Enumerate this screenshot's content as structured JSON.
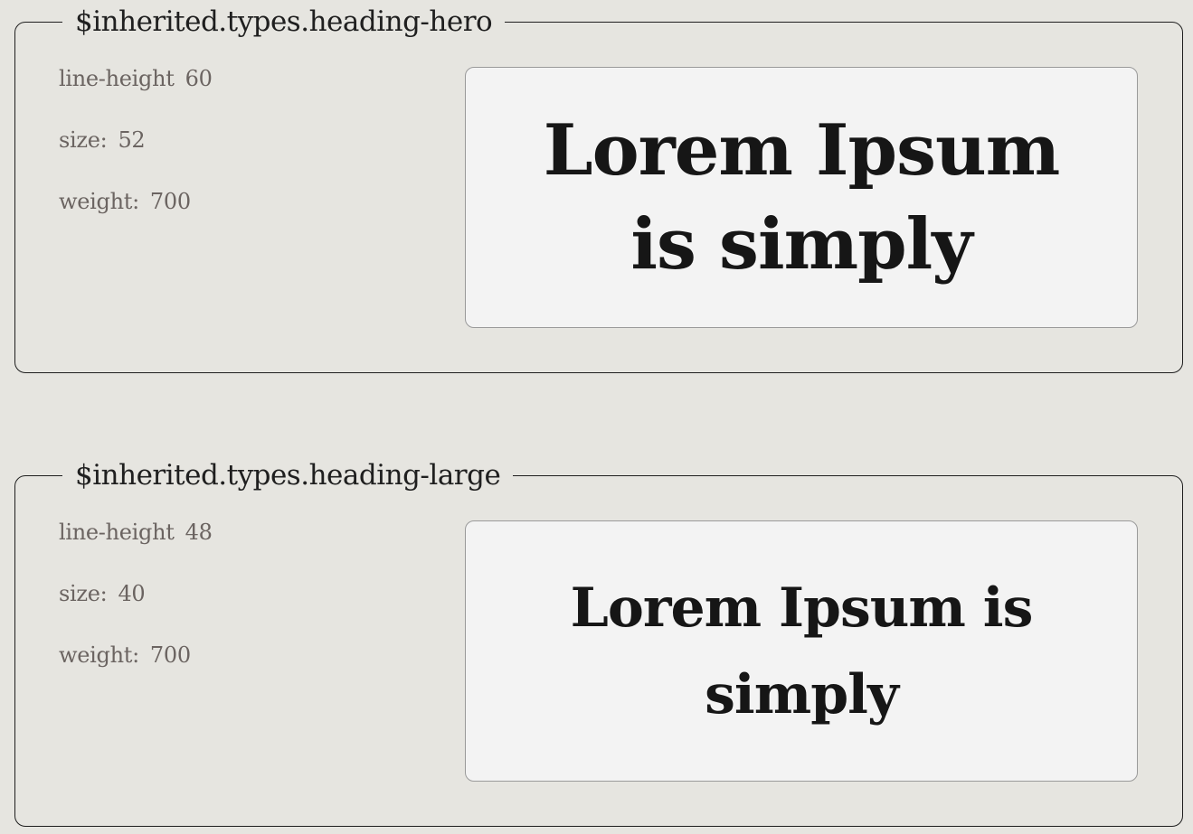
{
  "groups": [
    {
      "legend": "$inherited.types.heading-hero",
      "props": [
        {
          "name": "line-height",
          "value": "60"
        },
        {
          "name": "size:",
          "value": "52"
        },
        {
          "name": "weight:",
          "value": "700"
        }
      ],
      "preview_text": "Lorem Ipsum is simply"
    },
    {
      "legend": "$inherited.types.heading-large",
      "props": [
        {
          "name": "line-height",
          "value": "48"
        },
        {
          "name": "size:",
          "value": "40"
        },
        {
          "name": "weight:",
          "value": "700"
        }
      ],
      "preview_text": "Lorem Ipsum is simply"
    }
  ],
  "colors": {
    "background": "#e6e5e0",
    "border": "#1f1f1f",
    "preview_bg": "#f3f3f3",
    "preview_border": "#9a9a9a",
    "label_text": "#6b6461",
    "heading_text": "#161616"
  }
}
